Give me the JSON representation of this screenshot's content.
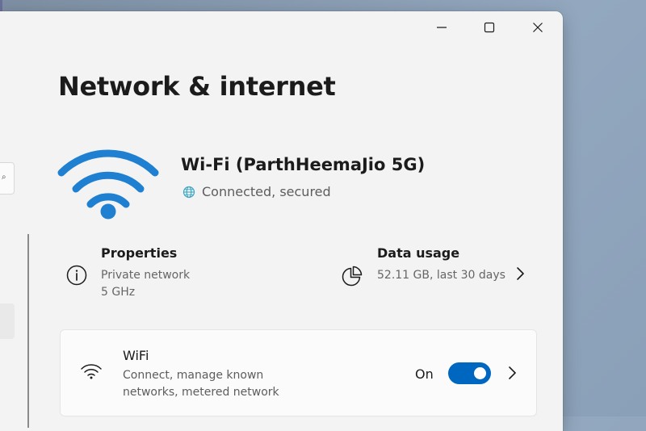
{
  "colors": {
    "accent": "#0067c0",
    "wifi_icon_blue": "#1f7fd1",
    "globe": "#3aa6c2",
    "window_bg": "#f3f3f3",
    "card_bg": "#fbfbfb"
  },
  "window": {
    "controls": [
      "minimize-icon",
      "maximize-icon",
      "close-icon"
    ]
  },
  "page": {
    "title": "Network & internet"
  },
  "hero": {
    "icon": "wifi-large-icon",
    "ssid": "Wi-Fi (ParthHeemaJio 5G)",
    "status_icon": "globe-icon",
    "status": "Connected, secured"
  },
  "properties": {
    "icon": "info-icon",
    "title": "Properties",
    "network_type": "Private network",
    "band": "5 GHz"
  },
  "data_usage": {
    "icon": "pie-chart-icon",
    "title": "Data usage",
    "summary": "52.11 GB, last 30 days"
  },
  "wifi_card": {
    "icon": "wifi-icon",
    "title": "WiFi",
    "desc_line1": "Connect, manage known",
    "desc_line2": "networks, metered network",
    "state_label": "On",
    "toggle_on": true
  }
}
